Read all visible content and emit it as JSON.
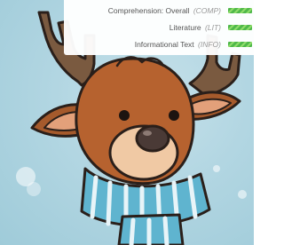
{
  "skills": [
    {
      "label": "Comprehension: Overall",
      "code": "(COMP)",
      "progress": 1.0,
      "color": "#4fb84a"
    },
    {
      "label": "Literature",
      "code": "(LIT)",
      "progress": 1.0,
      "color": "#4fb84a"
    },
    {
      "label": "Informational Text",
      "code": "(INFO)",
      "progress": 1.0,
      "color": "#4fb84a"
    }
  ],
  "background_image": {
    "subject": "reindeer-with-scarf",
    "scarf_color": "#5fb4cf"
  }
}
